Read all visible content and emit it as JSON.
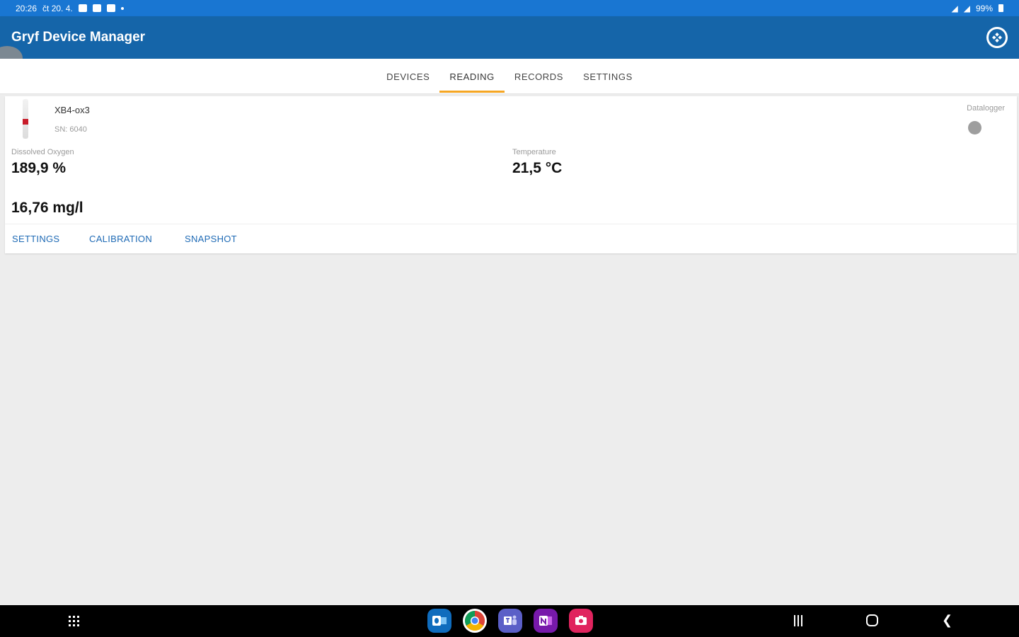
{
  "status_bar": {
    "time": "20:26",
    "date": "čt 20. 4.",
    "battery": "99%"
  },
  "app": {
    "title": "Gryf Device Manager"
  },
  "tabs": [
    {
      "label": "DEVICES",
      "active": false
    },
    {
      "label": "READING",
      "active": true
    },
    {
      "label": "RECORDS",
      "active": false
    },
    {
      "label": "SETTINGS",
      "active": false
    }
  ],
  "device": {
    "name": "XB4-ox3",
    "serial": "SN: 6040",
    "datalogger_label": "Datalogger",
    "measurements": {
      "oxygen_label": "Dissolved Oxygen",
      "oxygen_percent": "189,9 %",
      "oxygen_mgl": "16,76 mg/l",
      "temperature_label": "Temperature",
      "temperature_value": "21,5 °C"
    },
    "actions": {
      "settings": "SETTINGS",
      "calibration": "CALIBRATION",
      "snapshot": "SNAPSHOT"
    }
  },
  "colors": {
    "status_bar": "#1976d2",
    "app_bar": "#1565a9",
    "tab_indicator": "#f5a623",
    "action_text": "#1e6ab5",
    "probe_band": "#c81c2a"
  },
  "dock_apps": [
    "outlook-icon",
    "chrome-icon",
    "teams-icon",
    "onenote-icon",
    "camera-app-icon"
  ]
}
